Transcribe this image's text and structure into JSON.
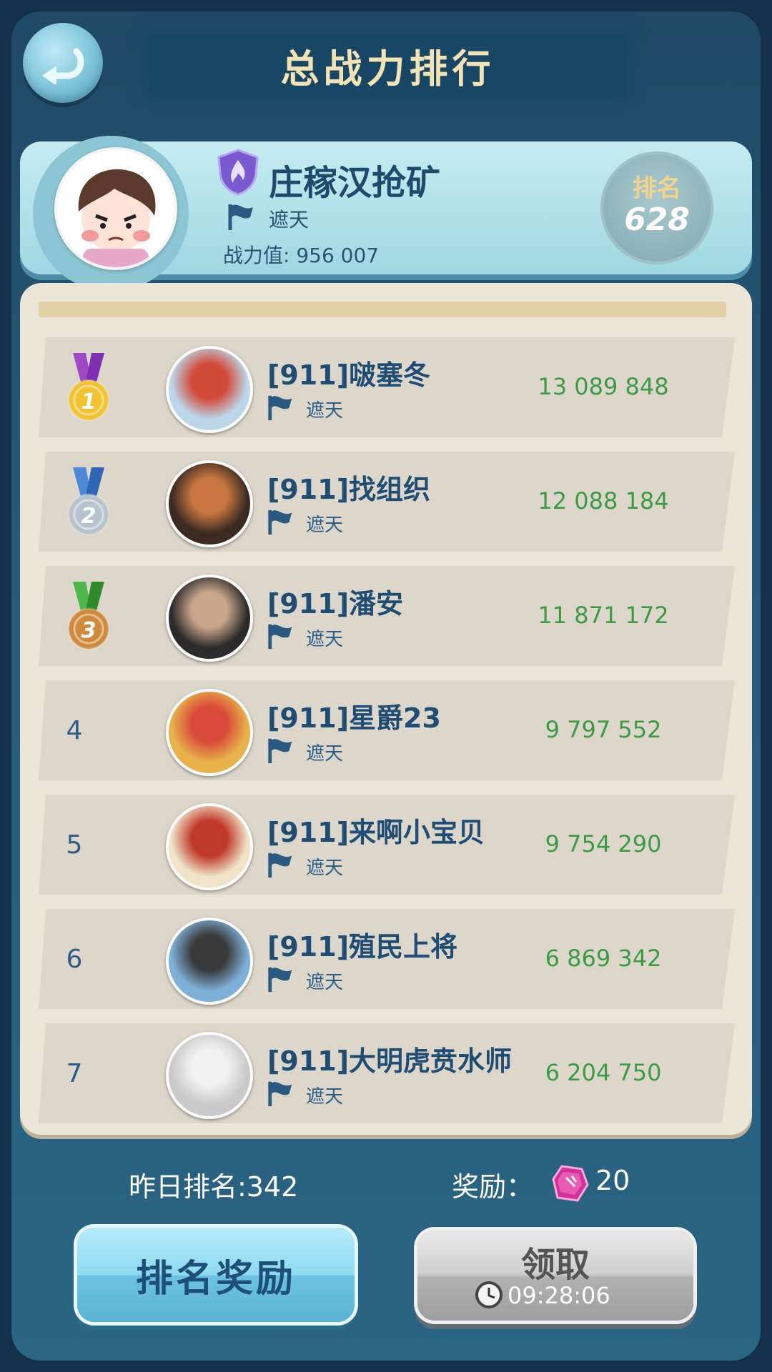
{
  "header": {
    "title": "总战力排行"
  },
  "me": {
    "name": "庄稼汉抢矿",
    "guild": "遮天",
    "power_text": "战力值: 956 007",
    "rank_label": "排名",
    "rank_value": "628"
  },
  "rows": [
    {
      "rank": "1",
      "medal": "gold",
      "name": "[911]啵塞冬",
      "guild": "遮天",
      "power": "13 089 848",
      "avatar_colors": [
        "#bcd7ea",
        "#d24b3a"
      ]
    },
    {
      "rank": "2",
      "medal": "silver",
      "name": "[911]找组织",
      "guild": "遮天",
      "power": "12 088 184",
      "avatar_colors": [
        "#3a2a22",
        "#c8763f"
      ]
    },
    {
      "rank": "3",
      "medal": "bronze",
      "name": "[911]潘安",
      "guild": "遮天",
      "power": "11 871 172",
      "avatar_colors": [
        "#2b2b2b",
        "#c9a58a"
      ]
    },
    {
      "rank": "4",
      "medal": "",
      "name": "[911]星爵23",
      "guild": "遮天",
      "power": "9 797 552",
      "avatar_colors": [
        "#e7b34a",
        "#d94a3a"
      ]
    },
    {
      "rank": "5",
      "medal": "",
      "name": "[911]来啊小宝贝",
      "guild": "遮天",
      "power": "9 754 290",
      "avatar_colors": [
        "#efe4c8",
        "#c0392b"
      ]
    },
    {
      "rank": "6",
      "medal": "",
      "name": "[911]殖民上将",
      "guild": "遮天",
      "power": "6 869 342",
      "avatar_colors": [
        "#7eb0d8",
        "#3a3a3a"
      ]
    },
    {
      "rank": "7",
      "medal": "",
      "name": "[911]大明虎贲水师",
      "guild": "遮天",
      "power": "6 204 750",
      "avatar_colors": [
        "#c9c9c9",
        "#f2f2f2"
      ]
    }
  ],
  "footer": {
    "yesterday_rank": "昨日排名:342",
    "reward_label": "奖励：",
    "reward_value": "20",
    "rank_reward_button": "排名奖励",
    "claim_button": "领取",
    "claim_timer": "09:28:06"
  },
  "colors": {
    "power_green": "#3d9b45",
    "name_blue": "#1f4d74",
    "gold": "#f2c230",
    "silver": "#b8c2cc",
    "bronze": "#d08a3c"
  }
}
